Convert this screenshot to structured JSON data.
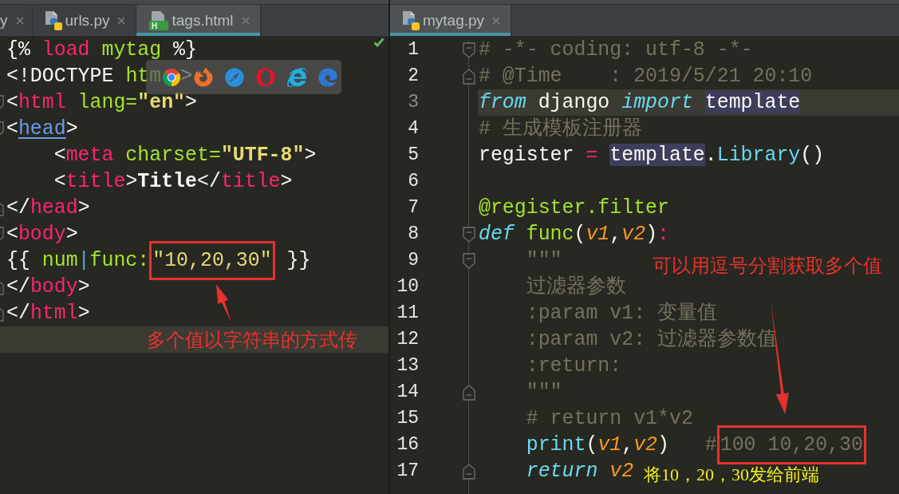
{
  "left_pane": {
    "tabs": [
      {
        "label": "y",
        "kind": "partial",
        "selected": false
      },
      {
        "label": "urls.py",
        "kind": "python",
        "selected": false
      },
      {
        "label": "tags.html",
        "kind": "html",
        "icon_text": "H",
        "selected": true
      }
    ],
    "lines": [
      {
        "kind": "plain",
        "current": false,
        "tokens": [
          {
            "kind": "plain",
            "text": "{% "
          },
          {
            "kind": "tag",
            "text": "load"
          },
          {
            "kind": "attr",
            "text": " mytag"
          },
          {
            "kind": "plain",
            "text": " %}"
          }
        ]
      },
      {
        "kind": "plain",
        "current": false,
        "tokens": [
          {
            "kind": "plain",
            "text": "<!DOCTYPE "
          },
          {
            "kind": "attr",
            "text": "htm"
          },
          {
            "kind": "covered"
          },
          {
            "kind": "plain",
            "text": ">"
          }
        ]
      },
      {
        "kind": "fold_start",
        "current": false,
        "tokens": [
          {
            "kind": "plain",
            "text": "<"
          },
          {
            "kind": "tag",
            "text": "html"
          },
          {
            "kind": "attr",
            "text": " lang="
          },
          {
            "kind": "string",
            "text": "\"en\""
          },
          {
            "kind": "plain",
            "text": ">"
          }
        ]
      },
      {
        "kind": "fold_start",
        "current": false,
        "tokens": [
          {
            "kind": "plain",
            "text": "<"
          },
          {
            "kind": "matched_tag",
            "text": "head"
          },
          {
            "kind": "plain",
            "text": ">"
          }
        ]
      },
      {
        "kind": "plain",
        "current": false,
        "tokens": [
          {
            "kind": "plain",
            "text": "    <"
          },
          {
            "kind": "tag",
            "text": "meta"
          },
          {
            "kind": "attr",
            "text": " charset="
          },
          {
            "kind": "string",
            "text": "\"UTF-8\""
          },
          {
            "kind": "plain",
            "text": ">"
          }
        ]
      },
      {
        "kind": "plain",
        "current": false,
        "tokens": [
          {
            "kind": "plain",
            "text": "    <"
          },
          {
            "kind": "tag",
            "text": "title"
          },
          {
            "kind": "plain",
            "text": ">"
          },
          {
            "kind": "bold_text",
            "text": "Title"
          },
          {
            "kind": "plain",
            "text": "</"
          },
          {
            "kind": "tag",
            "text": "title"
          },
          {
            "kind": "plain",
            "text": ">"
          }
        ]
      },
      {
        "kind": "fold_end",
        "current": false,
        "tokens": [
          {
            "kind": "plain",
            "text": "</"
          },
          {
            "kind": "tag",
            "text": "head"
          },
          {
            "kind": "plain",
            "text": ">"
          }
        ]
      },
      {
        "kind": "fold_start",
        "current": false,
        "tokens": [
          {
            "kind": "plain",
            "text": "<"
          },
          {
            "kind": "tag",
            "text": "body"
          },
          {
            "kind": "plain",
            "text": ">"
          }
        ]
      },
      {
        "kind": "plain",
        "current": false,
        "tokens": [
          {
            "kind": "plain",
            "text": "{{ "
          },
          {
            "kind": "attr",
            "text": "num"
          },
          {
            "kind": "pipe",
            "text": "|"
          },
          {
            "kind": "attr",
            "text": "func:"
          },
          {
            "kind": "boxed_value",
            "text": "\"10,20,30\""
          },
          {
            "kind": "plain",
            "text": " }}"
          }
        ]
      },
      {
        "kind": "fold_end",
        "current": false,
        "tokens": [
          {
            "kind": "plain",
            "text": "</"
          },
          {
            "kind": "tag",
            "text": "body"
          },
          {
            "kind": "plain",
            "text": ">"
          }
        ]
      },
      {
        "kind": "fold_end",
        "current": false,
        "tokens": [
          {
            "kind": "plain",
            "text": "</"
          },
          {
            "kind": "tag",
            "text": "html"
          },
          {
            "kind": "plain",
            "text": ">"
          }
        ]
      },
      {
        "kind": "plain",
        "current": true
      }
    ],
    "annotations": [
      {
        "kind": "arrow"
      },
      {
        "kind": "note",
        "text": "多个值以字符串的方式传",
        "color": "#e5322d"
      }
    ]
  },
  "right_pane": {
    "tabs": [
      {
        "label": "mytag.py",
        "kind": "python",
        "selected": true
      }
    ],
    "lines": [
      {
        "number": "1",
        "kind": "fold_start",
        "current": false,
        "tokens": [
          {
            "kind": "comment",
            "text": "# -*- coding: utf-8 -*-"
          }
        ]
      },
      {
        "number": "2",
        "kind": "fold_end",
        "current": false,
        "tokens": [
          {
            "kind": "comment",
            "text": "# @Time    : 2019/5/21 20:10"
          }
        ]
      },
      {
        "number": "3",
        "kind": "plain",
        "current": true,
        "tokens": [
          {
            "kind": "keyword",
            "text": "from"
          },
          {
            "kind": "plain",
            "text": " django "
          },
          {
            "kind": "keyword",
            "text": "import "
          },
          {
            "kind": "highlighted",
            "text": "template"
          }
        ]
      },
      {
        "number": "4",
        "kind": "plain",
        "current": false,
        "tokens": [
          {
            "kind": "comment",
            "text": "# 生成模板注册器"
          }
        ]
      },
      {
        "number": "5",
        "kind": "plain",
        "current": false,
        "tokens": [
          {
            "kind": "plain",
            "text": "register "
          },
          {
            "kind": "operator",
            "text": "= "
          },
          {
            "kind": "highlighted",
            "text": "template"
          },
          {
            "kind": "plain",
            "text": "."
          },
          {
            "kind": "builtin",
            "text": "Library"
          },
          {
            "kind": "plain",
            "text": "()"
          }
        ]
      },
      {
        "number": "6",
        "kind": "plain",
        "current": false
      },
      {
        "number": "7",
        "kind": "plain",
        "current": false,
        "tokens": [
          {
            "kind": "decorator",
            "text": "@register.filter"
          }
        ]
      },
      {
        "number": "8",
        "kind": "fold_start",
        "current": false,
        "tokens": [
          {
            "kind": "keyword",
            "text": "def "
          },
          {
            "kind": "func_name",
            "text": "func"
          },
          {
            "kind": "plain",
            "text": "("
          },
          {
            "kind": "param",
            "text": "v1"
          },
          {
            "kind": "plain",
            "text": ","
          },
          {
            "kind": "param",
            "text": "v2"
          },
          {
            "kind": "plain",
            "text": ")"
          },
          {
            "kind": "operator",
            "text": ":"
          }
        ]
      },
      {
        "number": "9",
        "kind": "fold_start",
        "current": false,
        "tokens": [
          {
            "kind": "comment",
            "text": "    \"\"\""
          }
        ]
      },
      {
        "number": "10",
        "kind": "plain",
        "current": false,
        "tokens": [
          {
            "kind": "comment",
            "text": "    过滤器参数"
          }
        ]
      },
      {
        "number": "11",
        "kind": "plain",
        "current": false,
        "tokens": [
          {
            "kind": "comment",
            "text": "    :param v1: 变量值"
          }
        ]
      },
      {
        "number": "12",
        "kind": "plain",
        "current": false,
        "tokens": [
          {
            "kind": "comment",
            "text": "    :param v2: 过滤器参数值"
          }
        ]
      },
      {
        "number": "13",
        "kind": "plain",
        "current": false,
        "tokens": [
          {
            "kind": "comment",
            "text": "    :return:"
          }
        ]
      },
      {
        "number": "14",
        "kind": "fold_end",
        "current": false,
        "tokens": [
          {
            "kind": "comment",
            "text": "    \"\"\""
          }
        ]
      },
      {
        "number": "15",
        "kind": "plain",
        "current": false,
        "tokens": [
          {
            "kind": "comment",
            "text": "    # return v1*v2"
          }
        ]
      },
      {
        "number": "16",
        "kind": "plain",
        "current": false,
        "tokens": [
          {
            "kind": "builtin",
            "text": "    print"
          },
          {
            "kind": "plain",
            "text": "("
          },
          {
            "kind": "param",
            "text": "v1"
          },
          {
            "kind": "plain",
            "text": ","
          },
          {
            "kind": "param",
            "text": "v2"
          },
          {
            "kind": "plain",
            "text": ")   "
          },
          {
            "kind": "comment",
            "text": "#"
          },
          {
            "kind": "boxed_comment",
            "text": "100 10,20,30"
          }
        ]
      },
      {
        "number": "17",
        "kind": "fold_end",
        "current": false,
        "tokens": [
          {
            "kind": "keyword",
            "text": "    return "
          },
          {
            "kind": "param",
            "text": "v2"
          }
        ]
      }
    ],
    "annotations": [
      {
        "kind": "note",
        "text": "可以用逗号分割获取多个值",
        "color": "#e5322d"
      },
      {
        "kind": "arrow"
      },
      {
        "kind": "note",
        "text": "将10，20，30发给前端",
        "color": "#f2f21c"
      }
    ]
  }
}
